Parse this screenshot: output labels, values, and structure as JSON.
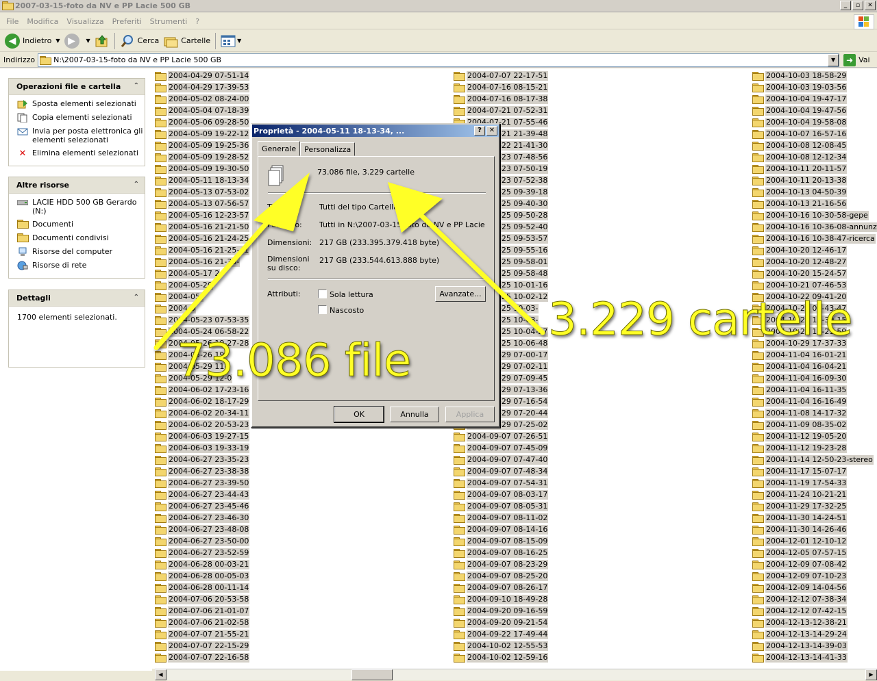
{
  "window": {
    "title": "2007-03-15-foto da NV e PP Lacie 500 GB",
    "min_label": "_",
    "max_label": "▫",
    "close_label": "✕"
  },
  "menu": [
    "File",
    "Modifica",
    "Visualizza",
    "Preferiti",
    "Strumenti",
    "?"
  ],
  "toolbar": {
    "back_label": "Indietro",
    "search_label": "Cerca",
    "folders_label": "Cartelle"
  },
  "address": {
    "label": "Indirizzo",
    "value": "N:\\2007-03-15-foto da NV e PP Lacie 500 GB",
    "go_label": "Vai"
  },
  "sidebar": {
    "file_ops": {
      "title": "Operazioni file e cartella",
      "items": [
        "Sposta elementi selezionati",
        "Copia elementi selezionati",
        "Invia per posta elettronica gli elementi selezionati",
        "Elimina elementi selezionati"
      ]
    },
    "other": {
      "title": "Altre risorse",
      "items": [
        "LACIE HDD 500 GB Gerardo (N:)",
        "Documenti",
        "Documenti condivisi",
        "Risorse del computer",
        "Risorse di rete"
      ]
    },
    "details": {
      "title": "Dettagli",
      "text": "1700 elementi selezionati."
    }
  },
  "files": {
    "col1": [
      "2004-04-29 07-51-14",
      "2004-04-29 17-39-53",
      "2004-05-02 08-24-00",
      "2004-05-04 07-18-39",
      "2004-05-06 09-28-50",
      "2004-05-09 19-22-12",
      "2004-05-09 19-25-36",
      "2004-05-09 19-28-52",
      "2004-05-09 19-30-50",
      "2004-05-11 18-13-34",
      "2004-05-13 07-53-02",
      "2004-05-13 07-56-57",
      "2004-05-16 12-23-57",
      "2004-05-16 21-21-50",
      "2004-05-16 21-24-25",
      "2004-05-16 21-25-41",
      "2004-05-16 21-33-",
      "2004-05-17 2",
      "2004-05-20",
      "2004-05-",
      "2004-0",
      "2004-05-23 07-53-35",
      "2004-05-24 06-58-22",
      "2004-05-26 19-27-28",
      "2004-05-26 19-",
      "2004-05-29 11-",
      "2004-05-29 12-0",
      "2004-06-02 17-23-16",
      "2004-06-02 18-17-29",
      "2004-06-02 20-34-11",
      "2004-06-02 20-53-23",
      "2004-06-03 19-27-15",
      "2004-06-03 19-33-19",
      "2004-06-27 23-35-23",
      "2004-06-27 23-38-38",
      "2004-06-27 23-39-50",
      "2004-06-27 23-44-43",
      "2004-06-27 23-45-46",
      "2004-06-27 23-46-30",
      "2004-06-27 23-48-08",
      "2004-06-27 23-50-00",
      "2004-06-27 23-52-59",
      "2004-06-28 00-03-21",
      "2004-06-28 00-05-03",
      "2004-06-28 00-11-14",
      "2004-07-06 20-53-58",
      "2004-07-06 21-01-07",
      "2004-07-06 21-02-58",
      "2004-07-07 21-55-21",
      "2004-07-07 22-15-29",
      "2004-07-07 22-16-58"
    ],
    "col2": [
      "2004-07-07 22-17-51",
      "2004-07-16 08-15-21",
      "2004-07-16 08-17-38",
      "2004-07-21 07-52-31",
      "2004-07-21 07-55-46",
      "2004-07-21 21-39-48",
      "2004-07-22 21-41-30",
      "2004-07-23 07-48-56",
      "2004-07-23 07-50-19",
      "2004-07-23 07-52-38",
      "2004-07-25 09-39-18",
      "2004-07-25 09-40-30",
      "2004-07-25 09-50-28",
      "2004-07-25 09-52-40",
      "2004-07-25 09-53-57",
      "2004-07-25 09-55-16",
      "2004-07-25 09-58-01",
      "2004-07-25 09-58-48",
      "2004-07-25 10-01-16",
      "2004-07-25 10-02-12",
      "2004-07-25 10-03-",
      "2004-07-25 10-03-",
      "2004-07-25 10-04-27",
      "2004-07-25 10-06-48",
      "2004-07-29 07-00-17",
      "2004-07-29 07-02-11",
      "2004-07-29 07-09-45",
      "2004-07-29 07-13-36",
      "2004-07-29 07-16-54",
      "2004-07-29 07-20-44",
      "2004-07-29 07-25-02",
      "2004-09-07 07-26-51",
      "2004-09-07 07-45-09",
      "2004-09-07 07-47-40",
      "2004-09-07 07-48-34",
      "2004-09-07 07-54-31",
      "2004-09-07 08-03-17",
      "2004-09-07 08-05-31",
      "2004-09-07 08-11-02",
      "2004-09-07 08-14-16",
      "2004-09-07 08-15-09",
      "2004-09-07 08-16-25",
      "2004-09-07 08-23-29",
      "2004-09-07 08-25-20",
      "2004-09-07 08-26-17",
      "2004-09-10 18-49-28",
      "2004-09-20 09-16-59",
      "2004-09-20 09-21-54",
      "2004-09-22 17-49-44",
      "2004-10-02 12-55-53",
      "2004-10-02 12-59-16"
    ],
    "col3": [
      "2004-10-03 18-58-29",
      "2004-10-03 19-03-56",
      "2004-10-04 19-47-17",
      "2004-10-04 19-47-56",
      "2004-10-04 19-58-08",
      "2004-10-07 16-57-16",
      "2004-10-08 12-08-45",
      "2004-10-08 12-12-34",
      "2004-10-11 20-11-57",
      "2004-10-11 20-13-38",
      "2004-10-13 04-50-39",
      "2004-10-13 21-16-56",
      "2004-10-16 10-30-58-gepe",
      "2004-10-16 10-36-08-annunzi",
      "2004-10-16 10-38-47-ricerca",
      "2004-10-20 12-46-17",
      "2004-10-20 12-48-27",
      "2004-10-20 15-24-57",
      "2004-10-21 07-46-53",
      "2004-10-22 09-41-20",
      "2004-10-22 09-43-47",
      "2004-10-24 13-39-15",
      "2004-10-28 17-21-59",
      "2004-10-29 17-37-33",
      "2004-11-04 16-01-21",
      "2004-11-04 16-04-21",
      "2004-11-04 16-09-30",
      "2004-11-04 16-11-35",
      "2004-11-04 16-16-49",
      "2004-11-08 14-17-32",
      "2004-11-09 08-35-02",
      "2004-11-12 19-05-20",
      "2004-11-12 19-23-28",
      "2004-11-14 12-50-23-stereo",
      "2004-11-17 15-07-17",
      "2004-11-19 17-54-33",
      "2004-11-24 10-21-21",
      "2004-11-29 17-32-25",
      "2004-11-30 14-24-51",
      "2004-11-30 14-26-46",
      "2004-12-01 12-10-12",
      "2004-12-05 07-57-15",
      "2004-12-09 07-08-42",
      "2004-12-09 07-10-23",
      "2004-12-09 14-04-56",
      "2004-12-12 07-38-34",
      "2004-12-12 07-42-15",
      "2004-12-13-12-38-21",
      "2004-12-13-14-29-24",
      "2004-12-13-14-39-03",
      "2004-12-13-14-41-33"
    ]
  },
  "dialog": {
    "title": "Proprietà - 2004-05-11 18-13-34, ...",
    "help_label": "?",
    "close_label": "✕",
    "tabs": [
      "Generale",
      "Personalizza"
    ],
    "summary": "73.086 file, 3.229 cartelle",
    "type_label": "Tipo:",
    "type_value": "Tutti del tipo Cartella di file",
    "location_label": "Percorso:",
    "location_value": "Tutti in N:\\2007-03-15-foto da NV e PP Lacie 500 GB",
    "size_label": "Dimensioni:",
    "size_value": "217 GB (233.395.379.418 byte)",
    "disk_label": "Dimensioni su disco:",
    "disk_value": "217 GB (233.544.613.888 byte)",
    "attr_label": "Attributi:",
    "readonly_label": "Sola lettura",
    "hidden_label": "Nascosto",
    "advanced_label": "Avanzate...",
    "ok_label": "OK",
    "cancel_label": "Annulla",
    "apply_label": "Applica"
  },
  "annotations": {
    "files_text": "73.086 file",
    "folders_text": "3.229 cartelle",
    "color": "#ffff26"
  }
}
